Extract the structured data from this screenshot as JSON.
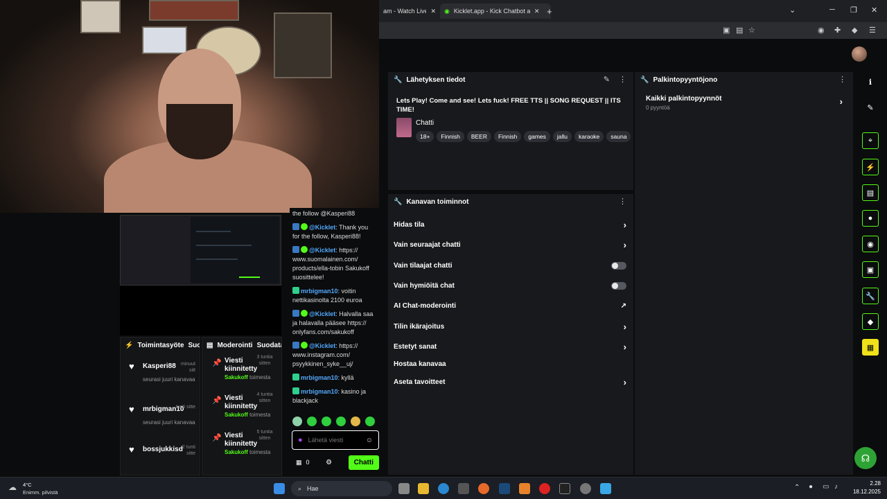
{
  "browser": {
    "tabs": [
      {
        "label": "am - Watch Live o"
      },
      {
        "label": "Kicklet.app - Kick Chatbot and C"
      }
    ],
    "new_tab": "+",
    "minimize": "─",
    "maximize": "❐",
    "close": "✕"
  },
  "stream_info": {
    "header": "Lähetyksen tiedot",
    "title": "Lets Play! Come and see! Lets fuck! FREE TTS || SONG REQUEST || ITS TIME!",
    "category": "Chatti",
    "tags": [
      "18+",
      "Finnish",
      "BEER",
      "Finnish",
      "games",
      "jallu",
      "karaoke",
      "sauna"
    ]
  },
  "channel_actions": {
    "header": "Kanavan toiminnot",
    "items": [
      {
        "label": "Hidas tila",
        "control": "chevron"
      },
      {
        "label": "Vain seuraajat chatti",
        "control": "chevron"
      },
      {
        "label": "Vain tilaajat chatti",
        "control": "toggle"
      },
      {
        "label": "Vain hymiöitä chat",
        "control": "toggle"
      },
      {
        "label": "AI Chat-moderointi",
        "control": "external"
      },
      {
        "label": "Tilin ikärajoitus",
        "control": "chevron"
      },
      {
        "label": "Estetyt sanat",
        "control": "chevron"
      },
      {
        "label": "Hostaa kanavaa",
        "control": "none"
      },
      {
        "label": "Aseta tavoitteet",
        "control": "chevron"
      }
    ]
  },
  "reward_queue": {
    "header": "Palkintopyyntöjono",
    "all_label": "Kaikki palkintopyynnöt",
    "count_label": "0 pyyntöä"
  },
  "activity": {
    "header": "Toimintasyöte",
    "filter": "Suod",
    "items": [
      {
        "name": "Kasperi88",
        "time": "minuut sitt",
        "sub": "seurasi juuri kanavaa"
      },
      {
        "name": "mrbigman10",
        "time": "tunti sitte",
        "sub": "seurasi juuri kanavaa"
      },
      {
        "name": "bossjukkisd",
        "time": "2 tunti sitte",
        "sub": ""
      }
    ]
  },
  "moderation": {
    "header": "Moderointi",
    "filter": "Suodata",
    "items": [
      {
        "title": "Viesti kiinnitetty",
        "time": "3 tuntia sitten",
        "by": "Sakukoff",
        "action": "toimesta"
      },
      {
        "title": "Viesti kiinnitetty",
        "time": "4 tuntia sitten",
        "by": "Sakukoff",
        "action": "toimesta"
      },
      {
        "title": "Viesti kiinnitetty",
        "time": "5 tuntia sitten",
        "by": "Sakukoff",
        "action": "toimesta"
      }
    ]
  },
  "chat": {
    "messages": [
      {
        "user": "",
        "text": "the follow @Kasperi88"
      },
      {
        "user": "@Kicklet",
        "text": ": Thank you for the follow, Kasperi88!"
      },
      {
        "user": "@Kicklet",
        "text": ": https:// www.suomalainen.com/ products/ella-tobin Sakukoff suosittelee!"
      },
      {
        "user": "mrbigman10",
        "text": ": voitin nettikasinolta 2100 euroa"
      },
      {
        "user": "@Kicklet",
        "text": ": Halvalla saa ja halavalla pääsee https:// onlyfans.com/sakukoff"
      },
      {
        "user": "@Kicklet",
        "text": ": https:// www.instagram.com/ psyykkinen_syke__uj/"
      },
      {
        "user": "mrbigman10",
        "text": ": kyllä"
      },
      {
        "user": "mrbigman10",
        "text": ": kasino ja blackjack"
      }
    ],
    "input_placeholder": "Lähetä viesti",
    "points": "0",
    "send_label": "Chatti"
  },
  "taskbar": {
    "weather_temp": "4°C",
    "weather_desc": "Enimm. pilvistä",
    "search": "Hae",
    "time": "2.28",
    "date": "18.12.2025"
  },
  "colors": {
    "kick_green": "#53fc18",
    "panel": "#18191c",
    "background": "#0b0c0d",
    "link_blue": "#53a8fc"
  }
}
